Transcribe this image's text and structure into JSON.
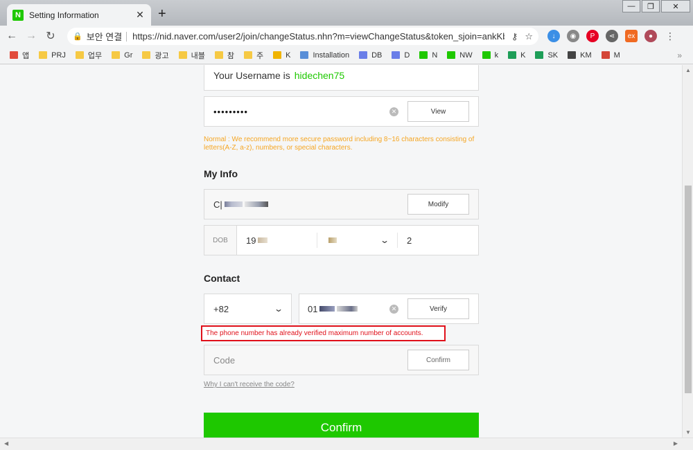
{
  "browser": {
    "tab_title": "Setting Information",
    "tab_favicon": "N",
    "security_label": "보안 연결",
    "url": "https://nid.naver.com/user2/join/changeStatus.nhn?m=viewChangeStatus&token_sjoin=ankKb...",
    "bookmarks": [
      {
        "label": "앱",
        "color": "#e14b3b"
      },
      {
        "label": "PRJ",
        "color": "#f6c944"
      },
      {
        "label": "업무",
        "color": "#f6c944"
      },
      {
        "label": "Gr",
        "color": "#f6c944"
      },
      {
        "label": "광고",
        "color": "#f6c944"
      },
      {
        "label": "내블",
        "color": "#f6c944"
      },
      {
        "label": "참",
        "color": "#f6c944"
      },
      {
        "label": "주",
        "color": "#f6c944"
      },
      {
        "label": "K",
        "color": "#f0b400"
      },
      {
        "label": "Installation",
        "color": "#5a8fd8"
      },
      {
        "label": "DB",
        "color": "#6a7ee8"
      },
      {
        "label": "D",
        "color": "#6a7ee8"
      },
      {
        "label": "N",
        "color": "#1ec800"
      },
      {
        "label": "NW",
        "color": "#1ec800"
      },
      {
        "label": "k",
        "color": "#1ec800"
      },
      {
        "label": "K",
        "color": "#1e9e58"
      },
      {
        "label": "SK",
        "color": "#1e9e58"
      },
      {
        "label": "KM",
        "color": "#444444"
      },
      {
        "label": "M",
        "color": "#d44638"
      }
    ],
    "bookmarks_more": "»"
  },
  "account": {
    "username_label": "Your Username is",
    "username": "hidechen75",
    "password_masked": "•••••••••",
    "view_button": "View",
    "password_note": "Normal : We recommend more secure password including 8~16 characters consisting of letters(A-Z, a-z), numbers, or special characters."
  },
  "my_info": {
    "title": "My Info",
    "name_prefix": "C|",
    "modify_button": "Modify",
    "dob_label": "DOB",
    "dob_year": "19",
    "dob_day": "2"
  },
  "contact": {
    "title": "Contact",
    "country_code": "+82",
    "phone_prefix": "01",
    "verify_button": "Verify",
    "error": "The phone number has already verified maximum number of accounts.",
    "code_placeholder": "Code",
    "confirm_code_button": "Confirm",
    "help_link": "Why I can't receive the code?"
  },
  "confirm_button": "Confirm",
  "colors": {
    "naver_green": "#1ec800",
    "error_red": "#e0101a",
    "warning_orange": "#f5a623"
  }
}
